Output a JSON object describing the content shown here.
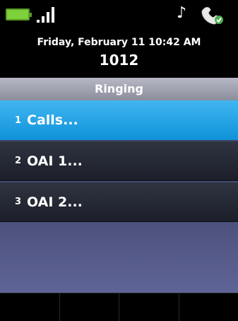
{
  "status": {
    "battery_icon": "battery-icon",
    "signal_icon": "signal-strength-icon",
    "ringer_icon": "music-note-icon",
    "phone_icon": "handset-icon"
  },
  "header": {
    "date_time": "Friday, February 11 10:42 AM",
    "extension": "1012"
  },
  "title": "Ringing",
  "items": [
    {
      "num": "1",
      "label": "Calls...",
      "selected": true
    },
    {
      "num": "2",
      "label": "OAI 1...",
      "selected": false
    },
    {
      "num": "3",
      "label": "OAI 2...",
      "selected": false
    }
  ],
  "softkeys": [
    "",
    "",
    "",
    ""
  ],
  "colors": {
    "selected": "#1ea5e6",
    "battery": "#7fd13b",
    "title_bar": "#a0a2b0"
  }
}
